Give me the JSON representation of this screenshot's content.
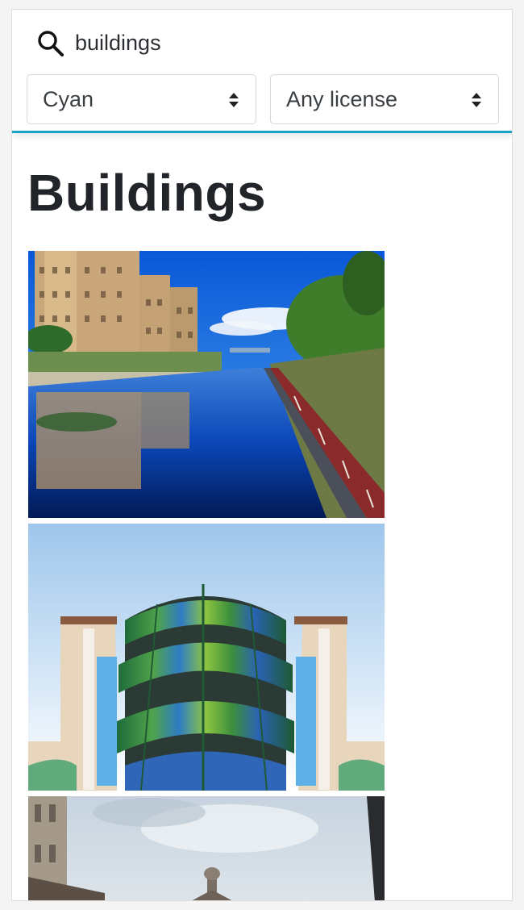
{
  "search": {
    "icon": "search-icon",
    "query": "buildings"
  },
  "filters": {
    "color": {
      "selected": "Cyan",
      "icon": "sort-arrows-icon"
    },
    "license": {
      "selected": "Any license",
      "icon": "sort-arrows-icon"
    }
  },
  "page": {
    "title": "Buildings"
  },
  "colors": {
    "accent": "#17a2c8",
    "title": "#212529",
    "border": "#d6d8da"
  }
}
